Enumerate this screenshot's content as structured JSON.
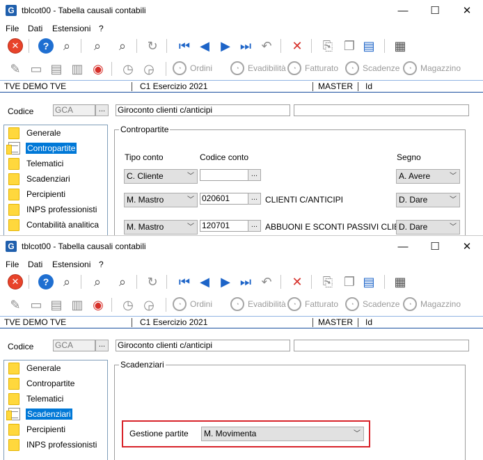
{
  "window1": {
    "title": "tblcot00 - Tabella causali contabili",
    "menu": [
      "File",
      "Dati",
      "Estensioni",
      "?"
    ],
    "toolbar2": {
      "ordini": "Ordini",
      "evadibilita": "Evadibilità",
      "fatturato": "Fatturato",
      "scadenze": "Scadenze",
      "magazzino": "Magazzino"
    },
    "status": {
      "company": "TVE DEMO TVE",
      "esercizio": "C1 Esercizio 2021",
      "user": "MASTER",
      "id": "Id"
    },
    "codice_label": "Codice",
    "codice_value": "GCA",
    "descrizione": "Giroconto clienti c/anticipi",
    "descrizione2": "",
    "nav": [
      "Generale",
      "Contropartite",
      "Telematici",
      "Scadenziari",
      "Percipienti",
      "INPS professionisti",
      "Contabilità analitica"
    ],
    "selected_nav": "Contropartite",
    "group_title": "Contropartite",
    "headers": {
      "tipo": "Tipo conto",
      "codice": "Codice conto",
      "segno": "Segno"
    },
    "rows": [
      {
        "tipo": "C. Cliente",
        "codice": "",
        "descr": "",
        "segno": "A. Avere"
      },
      {
        "tipo": "M. Mastro",
        "codice": "020601",
        "descr": "CLIENTI C/ANTICIPI",
        "segno": "D. Dare"
      },
      {
        "tipo": "M. Mastro",
        "codice": "120701",
        "descr": "ABBUONI E SCONTI PASSIVI CLIEN",
        "segno": "D. Dare"
      }
    ]
  },
  "window2": {
    "title": "tblcot00 - Tabella causali contabili",
    "menu": [
      "File",
      "Dati",
      "Estensioni",
      "?"
    ],
    "toolbar2": {
      "ordini": "Ordini",
      "evadibilita": "Evadibilità",
      "fatturato": "Fatturato",
      "scadenze": "Scadenze",
      "magazzino": "Magazzino"
    },
    "status": {
      "company": "TVE DEMO TVE",
      "esercizio": "C1 Esercizio 2021",
      "user": "MASTER",
      "id": "Id"
    },
    "codice_label": "Codice",
    "codice_value": "GCA",
    "descrizione": "Giroconto clienti c/anticipi",
    "descrizione2": "",
    "nav": [
      "Generale",
      "Contropartite",
      "Telematici",
      "Scadenziari",
      "Percipienti",
      "INPS professionisti"
    ],
    "selected_nav": "Scadenziari",
    "group_title": "Scadenziari",
    "gestione_label": "Gestione partite",
    "gestione_value": "M. Movimenta"
  },
  "colors": {
    "accent": "#0078d7",
    "highlight": "#d8232a",
    "status_border": "#1a4f9e"
  },
  "icons": {
    "toolbar1": [
      "close-icon",
      "help-icon",
      "binoculars-icon",
      "binoculars-prev-icon",
      "binoculars-next-icon",
      "refresh-icon",
      "first-record-icon",
      "previous-record-icon",
      "next-record-icon",
      "last-record-icon",
      "undo-icon",
      "delete-icon",
      "attachment-icon",
      "copy-icon",
      "layout-icon",
      "calendar-icon"
    ],
    "toolbar2": [
      "edit-icon",
      "new-doc-icon",
      "records-icon",
      "zoom-icon",
      "history-icon",
      "history-refresh-icon"
    ]
  }
}
